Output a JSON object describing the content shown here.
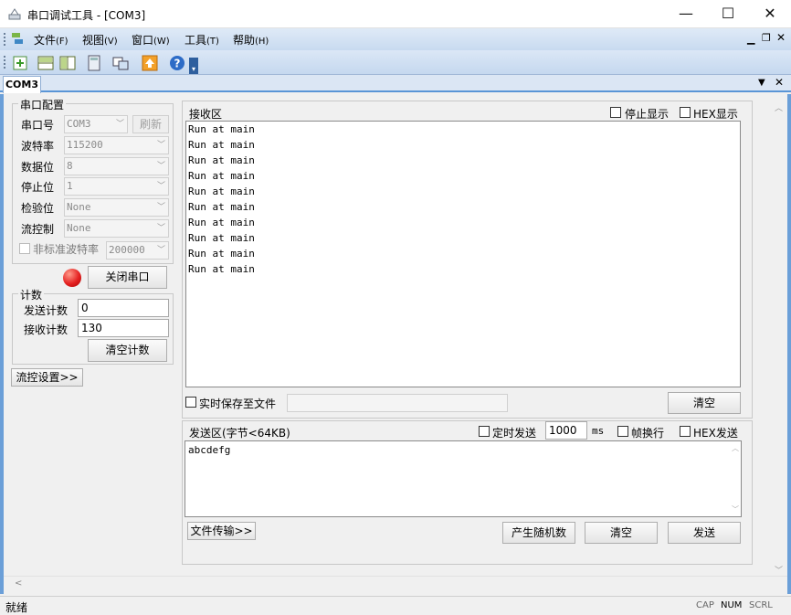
{
  "window": {
    "title": "串口调试工具 - [COM3]",
    "minimize": "—",
    "maximize": "☐",
    "close": "✕"
  },
  "menu": {
    "items": [
      {
        "label": "文件",
        "key": "(F)"
      },
      {
        "label": "视图",
        "key": "(V)"
      },
      {
        "label": "窗口",
        "key": "(W)"
      },
      {
        "label": "工具",
        "key": "(T)"
      },
      {
        "label": "帮助",
        "key": "(H)"
      }
    ]
  },
  "tab": {
    "label": "COM3"
  },
  "serial_config": {
    "title": "串口配置",
    "port": {
      "label": "串口号",
      "value": "COM3"
    },
    "refresh_label": "刷新",
    "baud": {
      "label": "波特率",
      "value": "115200"
    },
    "data_bits": {
      "label": "数据位",
      "value": "8"
    },
    "stop_bits": {
      "label": "停止位",
      "value": "1"
    },
    "parity": {
      "label": "检验位",
      "value": "None"
    },
    "flow": {
      "label": "流控制",
      "value": "None"
    },
    "nonstd_baud": {
      "label": "非标准波特率",
      "value": "200000"
    },
    "close_port_label": "关闭串口"
  },
  "counter": {
    "title": "计数",
    "tx_label": "发送计数",
    "tx_value": "0",
    "rx_label": "接收计数",
    "rx_value": "130",
    "clear_label": "清空计数"
  },
  "flow_settings_label": "流控设置>>",
  "receive": {
    "title": "接收区",
    "stop_display_label": "停止显示",
    "hex_display_label": "HEX显示",
    "lines": [
      "Run at main",
      "Run at main",
      "Run at main",
      "Run at main",
      "Run at main",
      "Run at main",
      "Run at main",
      "Run at main",
      "Run at main",
      "Run at main"
    ],
    "save_to_file_label": "实时保存至文件",
    "clear_label": "清空"
  },
  "send": {
    "title": "发送区(字节<64KB)",
    "timed_send_label": "定时发送",
    "interval_value": "1000",
    "interval_unit": "ms",
    "newline_label": "帧换行",
    "hex_send_label": "HEX发送",
    "text": "abcdefg",
    "file_transfer_label": "文件传输>>",
    "random_label": "产生随机数",
    "clear_label": "清空",
    "send_label": "发送"
  },
  "statusbar": {
    "ready": "就绪",
    "cap": "CAP",
    "num": "NUM",
    "scrl": "SCRL"
  },
  "colors": {
    "accent": "#5a95d6",
    "led_red": "#e52222"
  }
}
